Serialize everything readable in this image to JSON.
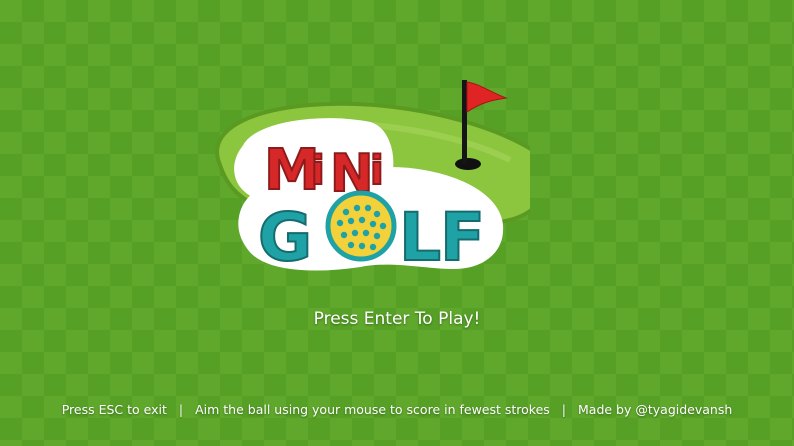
{
  "logo": {
    "word_top": "MiNi",
    "word_bottom": "GOLF",
    "letters_top": [
      "M",
      "i",
      "N",
      "i"
    ],
    "letters_bottom": [
      "G",
      "L",
      "F"
    ]
  },
  "prompt": "Press Enter To Play!",
  "footer": {
    "exit_hint": "Press ESC to exit",
    "separator": "|",
    "instructions": "Aim the ball using your mouse to score in fewest strokes",
    "credit": "Made by @tyagidevansh"
  },
  "colors": {
    "background_light": "#5fa82c",
    "background_dark": "#56a026",
    "green_blob": "#8cc63f",
    "title_red": "#d62828",
    "title_teal": "#1fa2a6",
    "ball_yellow": "#f2d13a",
    "flag_red": "#e02424",
    "text_white": "#ffffff"
  },
  "icons": [
    "golf-flag-icon",
    "golf-hole-icon",
    "golf-ball-icon"
  ]
}
